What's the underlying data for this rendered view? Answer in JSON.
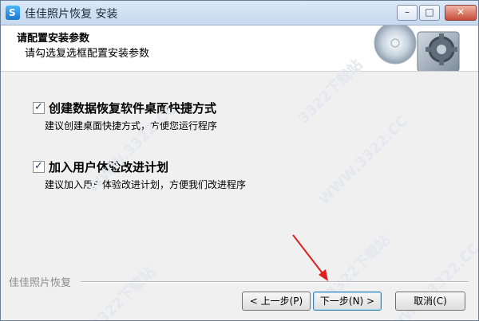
{
  "window": {
    "title": "佳佳照片恢复 安装",
    "minimize_glyph": "–",
    "maximize_glyph": "□",
    "close_glyph": "✕"
  },
  "header": {
    "title": "请配置安装参数",
    "subtitle": "请勾选复选框配置安装参数"
  },
  "options": [
    {
      "label": "创建数据恢复软件桌面快捷方式",
      "description": "建议创建桌面快捷方式，方便您运行程序",
      "checked": true,
      "check_glyph": "✓"
    },
    {
      "label": "加入用户体验改进计划",
      "description": "建议加入用户体验改进计划，方便我们改进程序",
      "checked": true,
      "check_glyph": "✓"
    }
  ],
  "footer": {
    "brand": "佳佳照片恢复",
    "back_label": "< 上一步(P)",
    "next_label": "下一步(N) >",
    "cancel_label": "取消(C)"
  },
  "watermarks": [
    "3322下载站",
    "WWW.3322.CC",
    "3322下载站",
    "WWW.3322.CC",
    "3322下载站",
    "WWW.3322.CC"
  ],
  "colors": {
    "arrow": "#e02020",
    "accent": "#3c7fb1"
  }
}
